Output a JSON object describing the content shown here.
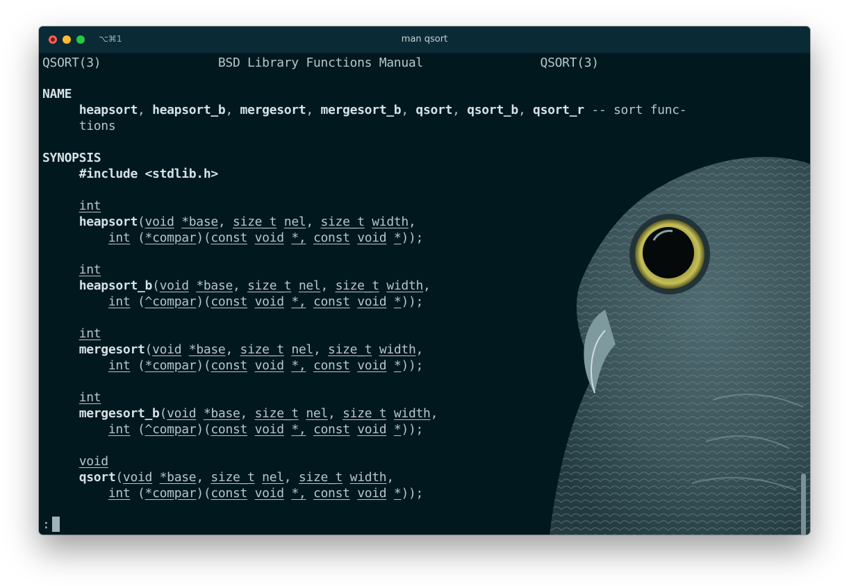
{
  "window": {
    "title": "man qsort",
    "shortcut": "⌥⌘1"
  },
  "man": {
    "header_left": "QSORT(3)",
    "header_center": "BSD Library Functions Manual",
    "header_right": "QSORT(3)",
    "name_heading": "NAME",
    "name_funcs": [
      "heapsort",
      "heapsort_b",
      "mergesort",
      "mergesort_b",
      "qsort",
      "qsort_b",
      "qsort_r"
    ],
    "name_desc": "-- sort func-",
    "name_desc_cont": "tions",
    "synopsis_heading": "SYNOPSIS",
    "include": "#include <stdlib.h>",
    "prototypes": [
      {
        "ret": "int",
        "name": "heapsort",
        "compar": "*compar"
      },
      {
        "ret": "int",
        "name": "heapsort_b",
        "compar": "^compar"
      },
      {
        "ret": "int",
        "name": "mergesort",
        "compar": "*compar"
      },
      {
        "ret": "int",
        "name": "mergesort_b",
        "compar": "^compar"
      },
      {
        "ret": "void",
        "name": "qsort",
        "compar": "*compar"
      }
    ],
    "tokens": {
      "void": "void",
      "base": "*base",
      "size_t": "size_t",
      "nel": "nel",
      "width": "width",
      "int": "int",
      "const": "const",
      "ptr": "*,"
    },
    "prompt": ":"
  }
}
